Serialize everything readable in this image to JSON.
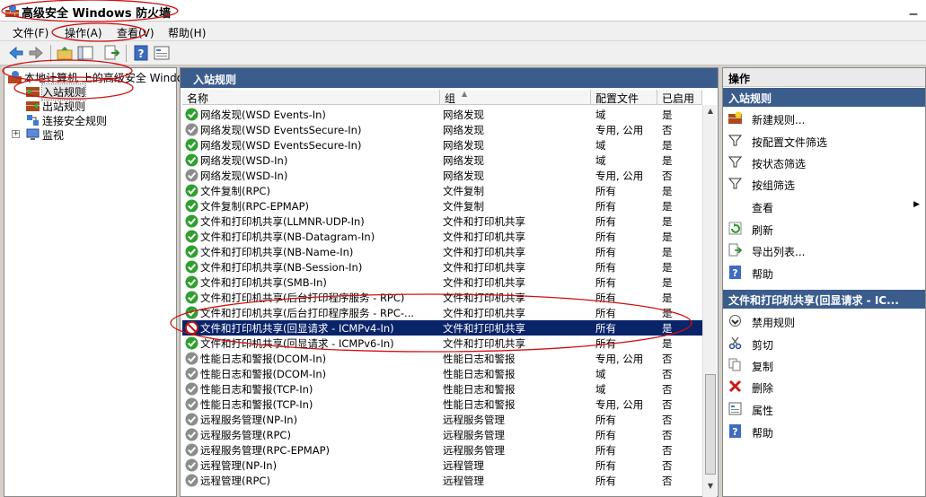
{
  "window": {
    "title": "高级安全 Windows 防火墙"
  },
  "menu": [
    "文件(F)",
    "操作(A)",
    "查看(V)",
    "帮助(H)"
  ],
  "tree": {
    "root": "本地计算机 上的高级安全 Windows 防火墙",
    "items": [
      "入站规则",
      "出站规则",
      "连接安全规则",
      "监视"
    ]
  },
  "center": {
    "title": "入站规则",
    "columns": [
      "名称",
      "组",
      "配置文件",
      "已启用"
    ],
    "rows": [
      {
        "name": "网络发现(WSD Events-In)",
        "group": "网络发现",
        "profile": "域",
        "enabled": "是",
        "status": "on"
      },
      {
        "name": "网络发现(WSD EventsSecure-In)",
        "group": "网络发现",
        "profile": "专用, 公用",
        "enabled": "否",
        "status": "off"
      },
      {
        "name": "网络发现(WSD EventsSecure-In)",
        "group": "网络发现",
        "profile": "域",
        "enabled": "是",
        "status": "on"
      },
      {
        "name": "网络发现(WSD-In)",
        "group": "网络发现",
        "profile": "域",
        "enabled": "是",
        "status": "on"
      },
      {
        "name": "网络发现(WSD-In)",
        "group": "网络发现",
        "profile": "专用, 公用",
        "enabled": "否",
        "status": "off"
      },
      {
        "name": "文件复制(RPC)",
        "group": "文件复制",
        "profile": "所有",
        "enabled": "是",
        "status": "on"
      },
      {
        "name": "文件复制(RPC-EPMAP)",
        "group": "文件复制",
        "profile": "所有",
        "enabled": "是",
        "status": "on"
      },
      {
        "name": "文件和打印机共享(LLMNR-UDP-In)",
        "group": "文件和打印机共享",
        "profile": "所有",
        "enabled": "是",
        "status": "on"
      },
      {
        "name": "文件和打印机共享(NB-Datagram-In)",
        "group": "文件和打印机共享",
        "profile": "所有",
        "enabled": "是",
        "status": "on"
      },
      {
        "name": "文件和打印机共享(NB-Name-In)",
        "group": "文件和打印机共享",
        "profile": "所有",
        "enabled": "是",
        "status": "on"
      },
      {
        "name": "文件和打印机共享(NB-Session-In)",
        "group": "文件和打印机共享",
        "profile": "所有",
        "enabled": "是",
        "status": "on"
      },
      {
        "name": "文件和打印机共享(SMB-In)",
        "group": "文件和打印机共享",
        "profile": "所有",
        "enabled": "是",
        "status": "on"
      },
      {
        "name": "文件和打印机共享(后台打印程序服务 - RPC)",
        "group": "文件和打印机共享",
        "profile": "所有",
        "enabled": "是",
        "status": "on"
      },
      {
        "name": "文件和打印机共享(后台打印程序服务 - RPC-...",
        "group": "文件和打印机共享",
        "profile": "所有",
        "enabled": "是",
        "status": "on"
      },
      {
        "name": "文件和打印机共享(回显请求 - ICMPv4-In)",
        "group": "文件和打印机共享",
        "profile": "所有",
        "enabled": "是",
        "status": "block",
        "selected": true
      },
      {
        "name": "文件和打印机共享(回显请求 - ICMPv6-In)",
        "group": "文件和打印机共享",
        "profile": "所有",
        "enabled": "是",
        "status": "on"
      },
      {
        "name": "性能日志和警报(DCOM-In)",
        "group": "性能日志和警报",
        "profile": "专用, 公用",
        "enabled": "否",
        "status": "off"
      },
      {
        "name": "性能日志和警报(DCOM-In)",
        "group": "性能日志和警报",
        "profile": "域",
        "enabled": "否",
        "status": "off"
      },
      {
        "name": "性能日志和警报(TCP-In)",
        "group": "性能日志和警报",
        "profile": "域",
        "enabled": "否",
        "status": "off"
      },
      {
        "name": "性能日志和警报(TCP-In)",
        "group": "性能日志和警报",
        "profile": "专用, 公用",
        "enabled": "否",
        "status": "off"
      },
      {
        "name": "远程服务管理(NP-In)",
        "group": "远程服务管理",
        "profile": "所有",
        "enabled": "否",
        "status": "off"
      },
      {
        "name": "远程服务管理(RPC)",
        "group": "远程服务管理",
        "profile": "所有",
        "enabled": "否",
        "status": "off"
      },
      {
        "name": "远程服务管理(RPC-EPMAP)",
        "group": "远程服务管理",
        "profile": "所有",
        "enabled": "否",
        "status": "off"
      },
      {
        "name": "远程管理(NP-In)",
        "group": "远程管理",
        "profile": "所有",
        "enabled": "否",
        "status": "off"
      },
      {
        "name": "远程管理(RPC)",
        "group": "远程管理",
        "profile": "所有",
        "enabled": "否",
        "status": "off"
      }
    ]
  },
  "actions": {
    "header": "操作",
    "section1": "入站规则",
    "items1": [
      "新建规则...",
      "按配置文件筛选",
      "按状态筛选",
      "按组筛选",
      "查看",
      "刷新",
      "导出列表...",
      "帮助"
    ],
    "section2": "文件和打印机共享(回显请求 - IC...",
    "items2": [
      "禁用规则",
      "剪切",
      "复制",
      "删除",
      "属性",
      "帮助"
    ]
  },
  "colors": {
    "accent": "#3b5d8c",
    "selection": "#0a246a",
    "enabled": "#2fa02f",
    "disabled": "#8c8c8c",
    "annotation": "#d01010"
  }
}
